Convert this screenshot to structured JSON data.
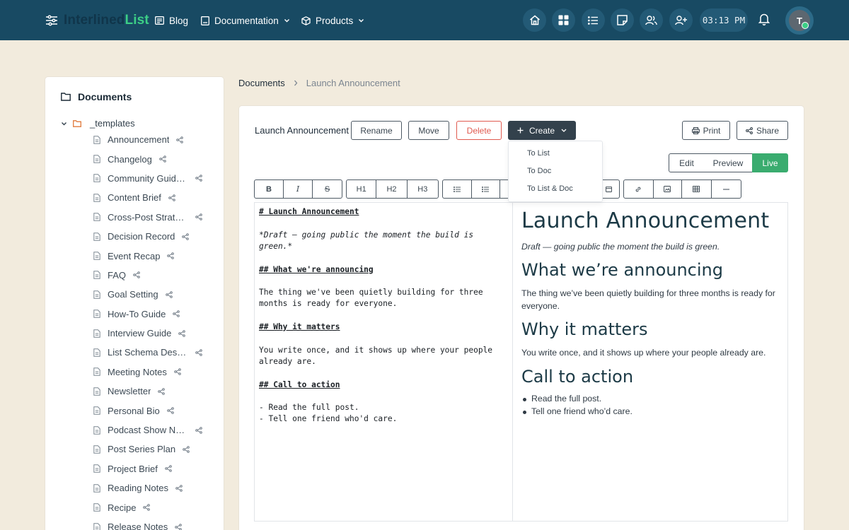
{
  "brand": {
    "part1": "Interlined",
    "part2": "List"
  },
  "nav": {
    "blog": "Blog",
    "documentation": "Documentation",
    "products": "Products",
    "clock": "03:13 PM",
    "avatar_initial": "T"
  },
  "sidebar": {
    "title": "Documents",
    "folder": "_templates",
    "items": [
      "Announcement",
      "Changelog",
      "Community Guideli...",
      "Content Brief",
      "Cross-Post Strategy",
      "Decision Record",
      "Event Recap",
      "FAQ",
      "Goal Setting",
      "How-To Guide",
      "Interview Guide",
      "List Schema Design",
      "Meeting Notes",
      "Newsletter",
      "Personal Bio",
      "Podcast Show Notes",
      "Post Series Plan",
      "Project Brief",
      "Reading Notes",
      "Recipe",
      "Release Notes"
    ]
  },
  "breadcrumb": {
    "root": "Documents",
    "current": "Launch Announcement"
  },
  "doc": {
    "title": "Launch Announcement",
    "rename": "Rename",
    "move": "Move",
    "delete": "Delete",
    "create": "Create",
    "print": "Print",
    "share": "Share",
    "create_menu": [
      "To List",
      "To Doc",
      "To List & Doc"
    ],
    "modes": {
      "edit": "Edit",
      "preview": "Preview",
      "live": "Live",
      "active": "Live"
    }
  },
  "toolbar": {
    "bold": "B",
    "italic": "I",
    "strike": "S",
    "h1": "H1",
    "h2": "H2",
    "h3": "H3"
  },
  "editor": {
    "lines": [
      {
        "text": "# Launch Announcement",
        "style": "h"
      },
      {
        "text": "",
        "style": ""
      },
      {
        "text": "*Draft — going public the moment the build is",
        "style": "i"
      },
      {
        "text": "green.*",
        "style": "i"
      },
      {
        "text": "",
        "style": ""
      },
      {
        "text": "## What we're announcing",
        "style": "h"
      },
      {
        "text": "",
        "style": ""
      },
      {
        "text": "The thing we've been quietly building for three",
        "style": ""
      },
      {
        "text": "months is ready for everyone.",
        "style": ""
      },
      {
        "text": "",
        "style": ""
      },
      {
        "text": "## Why it matters",
        "style": "h"
      },
      {
        "text": "",
        "style": ""
      },
      {
        "text": "You write once, and it shows up where your people",
        "style": ""
      },
      {
        "text": "already are.",
        "style": ""
      },
      {
        "text": "",
        "style": ""
      },
      {
        "text": "## Call to action",
        "style": "h"
      },
      {
        "text": "",
        "style": ""
      },
      {
        "text": "- Read the full post.",
        "style": ""
      },
      {
        "text": "- Tell one friend who'd care.",
        "style": ""
      }
    ]
  },
  "preview": {
    "h1": "Launch Announcement",
    "draft": "Draft — going public the moment the build is green.",
    "h2_1": "What we’re announcing",
    "p1": "The thing we’ve been quietly building for three months is ready for everyone.",
    "h2_2": "Why it matters",
    "p2": "You write once, and it shows up where your people already are.",
    "h2_3": "Call to action",
    "li1": "Read the full post.",
    "li2": "Tell one friend who’d care."
  },
  "colors": {
    "nav_bg": "#184a63",
    "accent_green": "#3ccf86",
    "live_green": "#3aac6f",
    "danger": "#e05a4f",
    "page_bg": "#f2ebdd"
  }
}
